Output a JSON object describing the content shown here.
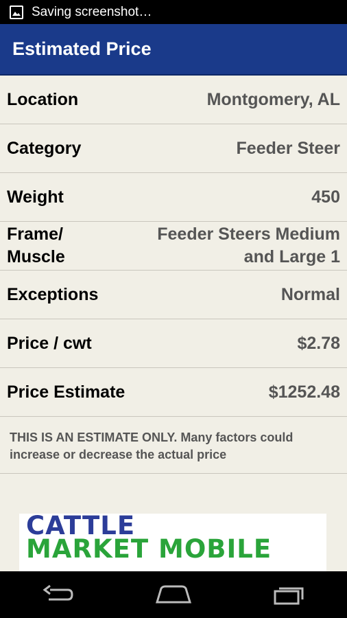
{
  "status_bar": {
    "text": "Saving screenshot…"
  },
  "app_bar": {
    "title": "Estimated Price"
  },
  "rows": [
    {
      "label": "Location",
      "value": "Montgomery, AL"
    },
    {
      "label": "Category",
      "value": "Feeder Steer"
    },
    {
      "label": "Weight",
      "value": "450"
    },
    {
      "label_line1": "Frame/",
      "label_line2": "Muscle",
      "value_line1": "Feeder Steers Medium",
      "value_line2": "and Large 1"
    },
    {
      "label": "Exceptions",
      "value": "Normal"
    },
    {
      "label": "Price / cwt",
      "value": "$2.78"
    },
    {
      "label": "Price Estimate",
      "value": "$1252.48"
    }
  ],
  "disclaimer": "THIS IS AN ESTIMATE ONLY.  Many factors could increase or decrease the actual price",
  "logo": {
    "line1": "CATTLE",
    "line2": "MARKET MOBILE"
  },
  "icons": {
    "status": "image-icon",
    "back": "back-icon",
    "home": "home-icon",
    "recents": "recent-apps-icon"
  },
  "colors": {
    "app_bar": "#1a3a8a",
    "background": "#f1efe6",
    "logo_blue": "#2c3d99",
    "logo_green": "#2aa43a"
  }
}
